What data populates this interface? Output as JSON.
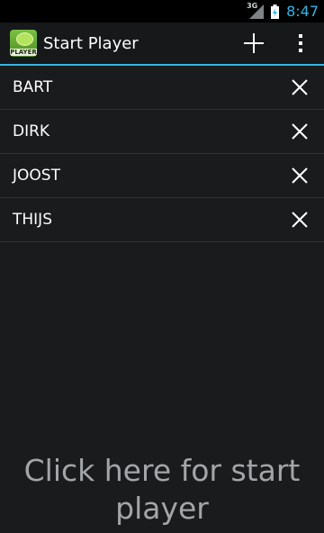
{
  "status_bar": {
    "network": "3G",
    "time": "8:47"
  },
  "app": {
    "icon_text": "PLAYER",
    "title": "Start Player"
  },
  "actions": {
    "add_icon": "plus-icon",
    "overflow_icon": "overflow-menu-icon"
  },
  "players": [
    {
      "name": "BART"
    },
    {
      "name": "DIRK"
    },
    {
      "name": "JOOST"
    },
    {
      "name": "THIJS"
    }
  ],
  "start_button": {
    "label": "Click here for start player"
  },
  "colors": {
    "accent": "#33b5e5",
    "background": "#1a1b1d",
    "text_muted": "#a3a6a8"
  }
}
